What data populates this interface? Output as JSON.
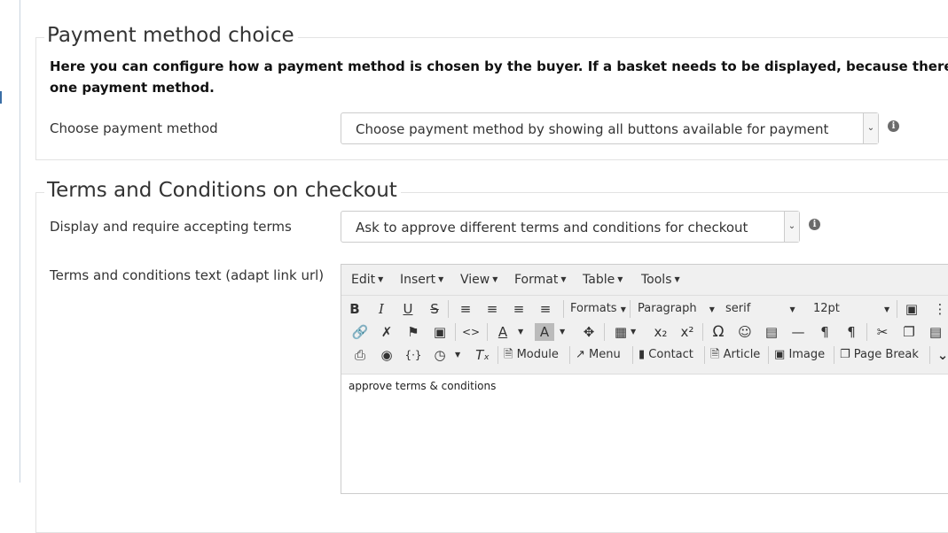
{
  "payment_section": {
    "legend": "Payment method choice",
    "intro_line1": "Here you can configure how a payment method is chosen by the buyer. If a basket needs to be displayed, because there is an introducti",
    "intro_line2": "one payment method.",
    "field_label": "Choose payment method",
    "select_value": "Choose payment method by showing all buttons available for payment"
  },
  "terms_section": {
    "legend": "Terms and Conditions on checkout",
    "display_label": "Display and require accepting terms",
    "display_select_value": "Ask to approve different terms and conditions for checkout",
    "text_label": "Terms and conditions text (adapt link url)"
  },
  "editor": {
    "menus": [
      "Edit",
      "Insert",
      "View",
      "Format",
      "Table",
      "Tools"
    ],
    "formats_label": "Formats",
    "block_label": "Paragraph",
    "font_family_label": "serif",
    "font_size_label": "12pt",
    "buttons": {
      "module": "Module",
      "menu": "Menu",
      "contact": "Contact",
      "article": "Article",
      "image": "Image",
      "page_break": "Page Break"
    },
    "content": "approve terms & conditions"
  },
  "icons": {
    "info": "info-icon",
    "dropdown": "chevron-down-icon"
  }
}
